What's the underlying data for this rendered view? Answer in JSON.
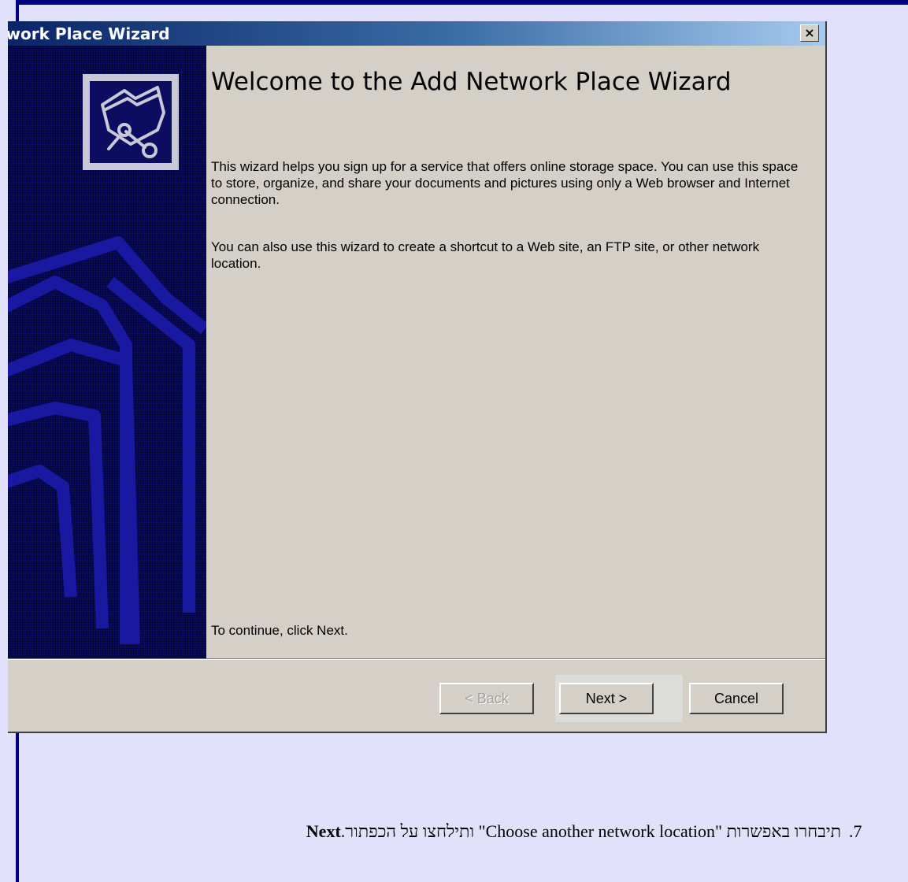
{
  "window": {
    "title": "twork Place Wizard",
    "close_label": "×"
  },
  "wizard": {
    "heading": "Welcome to the Add Network Place Wizard",
    "paragraph1": "This wizard helps you sign up for a service that offers online storage space. You can use this space to store, organize, and share your documents and pictures using only a Web browser and Internet connection.",
    "paragraph2": "You can also use this wizard to create a shortcut to a Web site, an FTP site, or other network location.",
    "continue_hint": "To continue, click Next."
  },
  "buttons": {
    "back": "< Back",
    "next": "Next >",
    "cancel": "Cancel"
  },
  "instruction": {
    "number": ".7",
    "text": "תיבחרו באפשרות \"Choose another network location\" ותילחצו על הכפתור.",
    "bold": "Next"
  },
  "icons": {
    "logo": "network-folder-icon",
    "close": "close-icon"
  },
  "colors": {
    "page_background": "#e1e1fb",
    "frame": "#000080",
    "side_panel": "#0a0a63",
    "dialog_face": "#d4d0c8"
  }
}
